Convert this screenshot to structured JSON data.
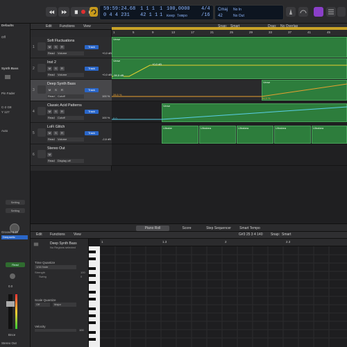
{
  "window_title": "vcai.04-10-2020 - Tracks",
  "colors": {
    "accent": "#2a66c8",
    "region": "#2d7d3c",
    "region_border": "#4aa35c",
    "automation": "#e8d030",
    "cycle": "#c8a227",
    "lcd_text": "#8fb8ff",
    "selected_track": "#47474a"
  },
  "transport": {
    "rewind_icon": "rewind-icon",
    "forward_icon": "fast-forward-icon",
    "stop_icon": "stop-icon",
    "play_icon": "play-icon",
    "record_icon": "record-icon",
    "cycle_icon": "cycle-icon"
  },
  "lcd": {
    "time": "59:59:24.68",
    "bars": "0 4 4 231",
    "beat1": "1  1  1",
    "beat2": "42 1 1",
    "sub1": "1",
    "sub2": "1",
    "tempo": "100,0000",
    "tempo_mode": "Keep Tempo",
    "sig": "4/4",
    "div": "/16",
    "key": "Cmaj",
    "key2": "42",
    "in": "No In",
    "out": "No Out"
  },
  "inspector": {
    "header": "Defaults",
    "off": "Off",
    "region_name": "Synth Bass",
    "pin_fader": "Pin Fader",
    "value_a": "C-2  G8",
    "value_b": "Y 127",
    "auto": "Auto",
    "setting1": "Setting",
    "setting2": "Setting",
    "group": "Groove 8 DI",
    "channel": "Deepsetic",
    "read": "Read",
    "fader_value": "0.0",
    "bnce": "Bnce",
    "stereo_out": "Stereo Out"
  },
  "tracks_toolbar": {
    "edit": "Edit",
    "functions": "Functions",
    "view": "View",
    "snap_label": "Snap:",
    "snap_value": "Smart",
    "drag_label": "Drag:",
    "drag_value": "No Overlap"
  },
  "ruler": {
    "marks": [
      "1",
      "5",
      "9",
      "13",
      "17",
      "21",
      "25",
      "29",
      "33",
      "37",
      "41",
      "45"
    ]
  },
  "tracks": [
    {
      "num": "1",
      "name": "Soft Fluctuations",
      "mode": "Read",
      "param": "Volume",
      "value": "+0,0 dB",
      "icon": "keyboard-icon",
      "button": "Track"
    },
    {
      "num": "2",
      "name": "Inst 2",
      "mode": "Read",
      "param": "Volume",
      "value": "+0,0 dB",
      "icon": "keyboard-icon",
      "button": "Track"
    },
    {
      "num": "3",
      "name": "Deep Synth Bass",
      "mode": "Read",
      "param": "Cutoff",
      "value": "100 %",
      "icon": "synth-icon",
      "button": "Track"
    },
    {
      "num": "4",
      "name": "Classic Acid Patterns",
      "mode": "Read",
      "param": "Cutoff",
      "value": "100 %",
      "icon": "synth-icon",
      "button": "Track"
    },
    {
      "num": "5",
      "name": "LoFi Glitch",
      "mode": "Read",
      "param": "Volume",
      "value": "-2,6 dB",
      "icon": "drums-icon",
      "button": "Track"
    },
    {
      "num": "6",
      "name": "Stereo Out",
      "mode": "Read",
      "param": "Display off",
      "value": "",
      "icon": "speaker-icon",
      "button": ""
    }
  ],
  "regions": {
    "verse_a": "Verse",
    "verse_b": "Verse",
    "verse_c": "Verse",
    "verse_d": "Verse",
    "ultrabeat": [
      "Ultrabe",
      "Ultrabea",
      "Ultrabea",
      "Ultrabea",
      "Ultrabea"
    ],
    "auto_labels": [
      "-59,5 dB",
      "+0,0 dB",
      "28,5 %",
      "34,5 %",
      "0,0"
    ]
  },
  "piano_roll": {
    "tabs": [
      "Piano Roll",
      "Score",
      "Step Sequencer",
      "Smart Tempo"
    ],
    "edit": "Edit",
    "functions": "Functions",
    "view": "View",
    "position": "G#3  25 3 4 140",
    "snap_label": "Snap:",
    "snap_value": "Smart",
    "region_name": "Deep Synth Bass",
    "region_sub": "No Regions selected",
    "time_quantize": "Time Quantize",
    "quantize_value": "1/16 Note",
    "strength_label": "Strength",
    "strength_value": "100",
    "swing_label": "Swing",
    "swing_value": "0",
    "scale_quantize": "Scale Quantize",
    "scale_off": "Off",
    "scale_major": "Major",
    "velocity_label": "Velocity",
    "velocity_value": "100",
    "ruler_marks": [
      "1",
      "1.3",
      "2",
      "2.3"
    ]
  }
}
